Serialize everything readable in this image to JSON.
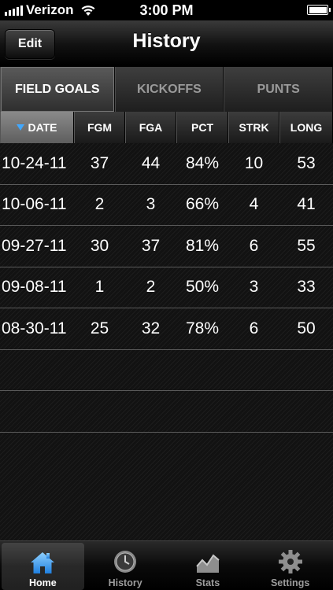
{
  "status": {
    "carrier": "Verizon",
    "time": "3:00 PM"
  },
  "nav": {
    "edit_label": "Edit",
    "title": "History"
  },
  "segments": [
    {
      "label": "FIELD GOALS",
      "active": true
    },
    {
      "label": "KICKOFFS",
      "active": false
    },
    {
      "label": "PUNTS",
      "active": false
    }
  ],
  "columns": [
    "DATE",
    "FGM",
    "FGA",
    "PCT",
    "STRK",
    "LONG"
  ],
  "sort_column": "DATE",
  "rows": [
    {
      "date": "10-24-11",
      "fgm": "37",
      "fga": "44",
      "pct": "84%",
      "strk": "10",
      "long": "53"
    },
    {
      "date": "10-06-11",
      "fgm": "2",
      "fga": "3",
      "pct": "66%",
      "strk": "4",
      "long": "41"
    },
    {
      "date": "09-27-11",
      "fgm": "30",
      "fga": "37",
      "pct": "81%",
      "strk": "6",
      "long": "55"
    },
    {
      "date": "09-08-11",
      "fgm": "1",
      "fga": "2",
      "pct": "50%",
      "strk": "3",
      "long": "33"
    },
    {
      "date": "08-30-11",
      "fgm": "25",
      "fga": "32",
      "pct": "78%",
      "strk": "6",
      "long": "50"
    }
  ],
  "tabs": [
    {
      "label": "Home",
      "icon": "home-icon",
      "active": true
    },
    {
      "label": "History",
      "icon": "clock-icon",
      "active": false
    },
    {
      "label": "Stats",
      "icon": "chart-icon",
      "active": false
    },
    {
      "label": "Settings",
      "icon": "gear-icon",
      "active": false
    }
  ],
  "colors": {
    "accent": "#41a8ff"
  }
}
